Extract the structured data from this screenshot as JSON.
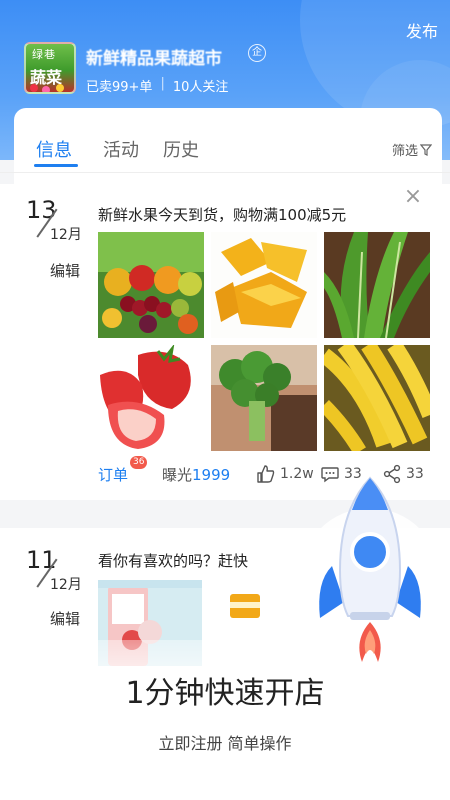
{
  "header": {
    "publish_label": "发布",
    "logo_text_top": "绿巷",
    "logo_text_bottom": "蔬菜",
    "shop_name": "新鲜精品果蔬超市",
    "shop_badge": "企",
    "sold": "已卖99+单",
    "followers": "10人关注"
  },
  "tabs": {
    "items": [
      {
        "label": "信息",
        "active": true
      },
      {
        "label": "活动",
        "active": false
      },
      {
        "label": "历史",
        "active": false
      }
    ],
    "filter_label": "筛选"
  },
  "posts": [
    {
      "day": "13",
      "month": "12月",
      "edit_label": "编辑",
      "text": "新鲜水果今天到货，购物满100减5元",
      "images": [
        "fruit-basket",
        "star-fruit",
        "lettuce",
        "strawberry",
        "broccoli",
        "banana"
      ],
      "order_label": "订单",
      "order_count": "36",
      "exposure_label": "曝光",
      "exposure_count": "1999",
      "likes": "1.2w",
      "comments": "33",
      "shares": "33"
    },
    {
      "day": "11",
      "month": "12月",
      "edit_label": "编辑",
      "text": "看你有喜欢的吗？赶快"
    }
  ],
  "promo": {
    "title": "1分钟快速开店",
    "subtitle": "立即注册 简单操作"
  },
  "colors": {
    "accent": "#1e7ff0",
    "header_blue": "#3d8ef5",
    "badge_red": "#f25a4b"
  }
}
